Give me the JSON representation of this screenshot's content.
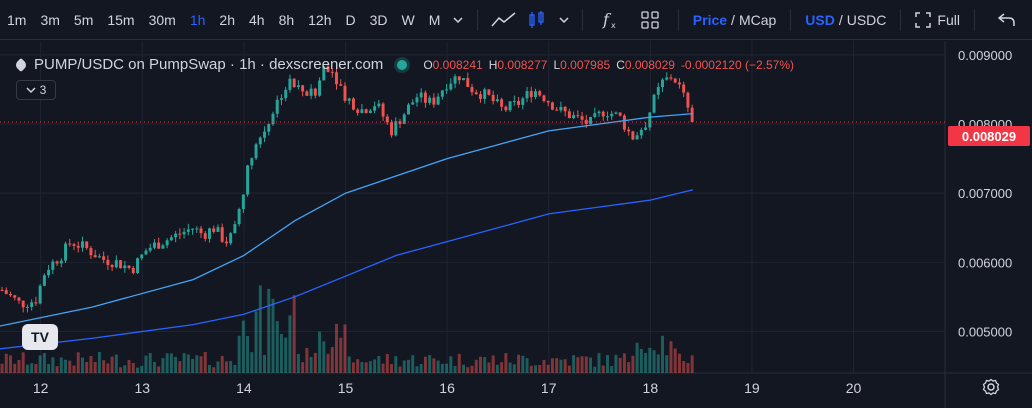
{
  "toolbar": {
    "timeframes": [
      "1m",
      "3m",
      "5m",
      "15m",
      "30m",
      "1h",
      "2h",
      "4h",
      "8h",
      "12h",
      "D",
      "3D",
      "W",
      "M"
    ],
    "active_timeframe": "1h",
    "price_label": "Price",
    "mcap_label": "MCap",
    "usd_label": "USD",
    "usdc_label": "USDC",
    "fullscreen_label": "Full"
  },
  "legend": {
    "title": "PUMP/USDC on PumpSwap · 1h · dexscreener.com",
    "o_label": "O",
    "o_value": "0.008241",
    "h_label": "H",
    "h_value": "0.008277",
    "l_label": "L",
    "l_value": "0.007985",
    "c_label": "C",
    "c_value": "0.008029",
    "change": "-0.0002120 (−2.57%)",
    "indicators_count": "3"
  },
  "last_price_label": "0.008029",
  "logo_text": "TV",
  "colors": {
    "up": "#26a69a",
    "down": "#ef5350",
    "ma_fast": "#42a5f5",
    "ma_slow": "#2962ff",
    "background": "#131722",
    "last_price": "#f23645"
  },
  "chart_data": {
    "type": "candlestick",
    "ylim": [
      0.0044,
      0.0092
    ],
    "yticks": [
      0.005,
      0.006,
      0.007,
      0.008,
      0.009
    ],
    "ytick_labels": [
      "0.005000",
      "0.006000",
      "0.007000",
      "0.008000",
      "0.009000"
    ],
    "xlim": [
      11.6,
      20.9
    ],
    "xticks": [
      12,
      13,
      14,
      15,
      16,
      17,
      18,
      19,
      20
    ],
    "xtick_labels": [
      "12",
      "13",
      "14",
      "15",
      "16",
      "17",
      "18",
      "19",
      "20"
    ],
    "last_price": 0.008029,
    "last_x": 18.42,
    "price_path": [
      [
        11.62,
        0.0056
      ],
      [
        11.8,
        0.0054
      ],
      [
        11.95,
        0.00545
      ],
      [
        12.05,
        0.0059
      ],
      [
        12.2,
        0.0061
      ],
      [
        12.3,
        0.0063
      ],
      [
        12.45,
        0.0062
      ],
      [
        12.6,
        0.00605
      ],
      [
        12.75,
        0.006
      ],
      [
        12.9,
        0.0059
      ],
      [
        13.05,
        0.0062
      ],
      [
        13.2,
        0.0063
      ],
      [
        13.35,
        0.0064
      ],
      [
        13.5,
        0.0065
      ],
      [
        13.6,
        0.0064
      ],
      [
        13.7,
        0.0065
      ],
      [
        13.82,
        0.0063
      ],
      [
        13.9,
        0.0064
      ],
      [
        14.0,
        0.0071
      ],
      [
        14.08,
        0.0076
      ],
      [
        14.2,
        0.0079
      ],
      [
        14.35,
        0.0084
      ],
      [
        14.45,
        0.0086
      ],
      [
        14.55,
        0.0085
      ],
      [
        14.7,
        0.0084
      ],
      [
        14.8,
        0.0089
      ],
      [
        14.9,
        0.0087
      ],
      [
        15.0,
        0.0084
      ],
      [
        15.15,
        0.0082
      ],
      [
        15.3,
        0.0083
      ],
      [
        15.45,
        0.0079
      ],
      [
        15.55,
        0.0081
      ],
      [
        15.7,
        0.0084
      ],
      [
        15.85,
        0.0083
      ],
      [
        16.0,
        0.0086
      ],
      [
        16.12,
        0.0087
      ],
      [
        16.25,
        0.0085
      ],
      [
        16.4,
        0.0084
      ],
      [
        16.55,
        0.0082
      ],
      [
        16.7,
        0.0083
      ],
      [
        16.85,
        0.0085
      ],
      [
        16.95,
        0.0084
      ],
      [
        17.1,
        0.0082
      ],
      [
        17.25,
        0.0081
      ],
      [
        17.4,
        0.008
      ],
      [
        17.55,
        0.0082
      ],
      [
        17.7,
        0.0081
      ],
      [
        17.82,
        0.0078
      ],
      [
        17.95,
        0.008
      ],
      [
        18.05,
        0.0084
      ],
      [
        18.12,
        0.0086
      ],
      [
        18.22,
        0.0087
      ],
      [
        18.3,
        0.0085
      ],
      [
        18.42,
        0.008029
      ]
    ],
    "ma_fast": [
      [
        11.6,
        0.00508
      ],
      [
        12.5,
        0.00535
      ],
      [
        13.5,
        0.00575
      ],
      [
        14.0,
        0.0061
      ],
      [
        14.5,
        0.0066
      ],
      [
        15.0,
        0.007
      ],
      [
        15.5,
        0.00725
      ],
      [
        16.0,
        0.0075
      ],
      [
        16.5,
        0.0077
      ],
      [
        17.0,
        0.0079
      ],
      [
        17.5,
        0.008
      ],
      [
        18.0,
        0.0081
      ],
      [
        18.42,
        0.00815
      ]
    ],
    "ma_slow": [
      [
        11.6,
        0.00475
      ],
      [
        12.5,
        0.0049
      ],
      [
        13.5,
        0.0051
      ],
      [
        14.0,
        0.00525
      ],
      [
        14.5,
        0.0055
      ],
      [
        15.0,
        0.0058
      ],
      [
        15.5,
        0.0061
      ],
      [
        16.0,
        0.0063
      ],
      [
        16.5,
        0.0065
      ],
      [
        17.0,
        0.0067
      ],
      [
        17.5,
        0.0068
      ],
      [
        18.0,
        0.0069
      ],
      [
        18.42,
        0.00705
      ]
    ],
    "volume_max_rel": 1.0,
    "grid": true
  }
}
